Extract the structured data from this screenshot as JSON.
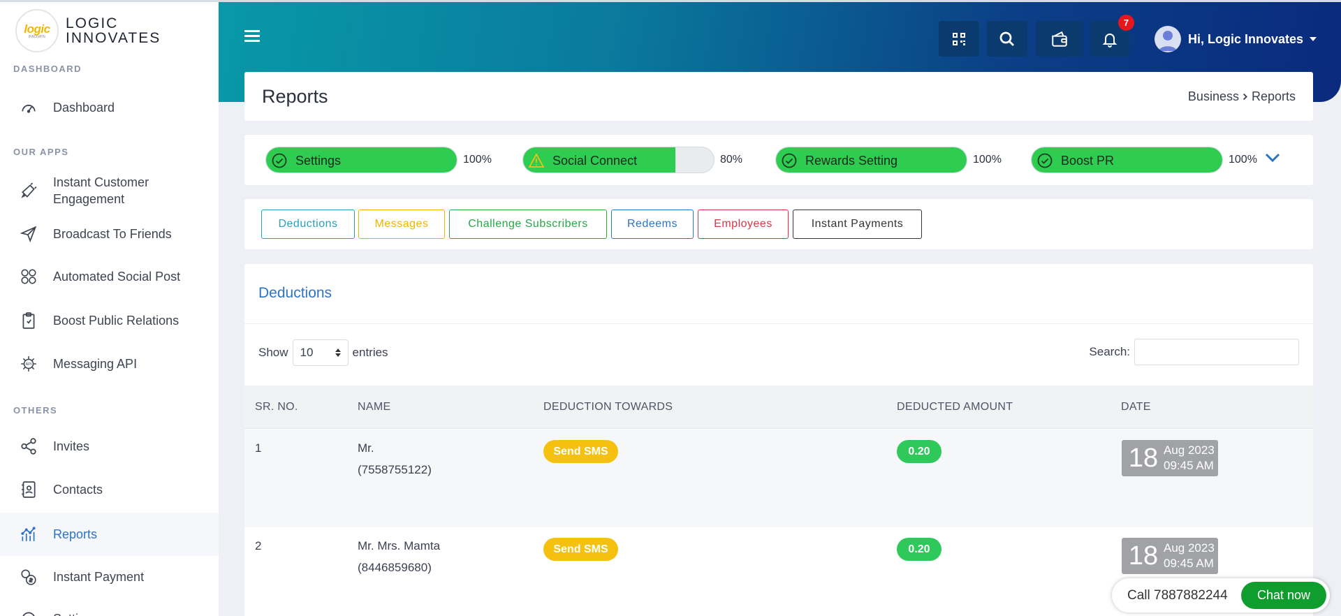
{
  "brand": {
    "logo_mark": "logic",
    "logo_sub": "INNOVATE",
    "name_line1": "LOGIC",
    "name_line2": "INNOVATES"
  },
  "sidebar": {
    "sections": [
      "DASHBOARD",
      "OUR APPS",
      "OTHERS"
    ],
    "items": [
      {
        "label": "Dashboard",
        "icon": "gauge-icon"
      },
      {
        "label": "Instant Customer Engagement",
        "icon": "megaphone-icon"
      },
      {
        "label": "Broadcast To Friends",
        "icon": "send-icon"
      },
      {
        "label": "Automated Social Post",
        "icon": "social-icon"
      },
      {
        "label": "Boost Public Relations",
        "icon": "clipboard-icon"
      },
      {
        "label": "Messaging API",
        "icon": "api-icon"
      },
      {
        "label": "Invites",
        "icon": "share-icon"
      },
      {
        "label": "Contacts",
        "icon": "contacts-icon"
      },
      {
        "label": "Reports",
        "icon": "chart-icon"
      },
      {
        "label": "Instant Payment",
        "icon": "payment-icon"
      },
      {
        "label": "Settings",
        "icon": "gear-icon"
      }
    ]
  },
  "topbar": {
    "notifications_count": "7",
    "greeting": "Hi, Logic Innovates"
  },
  "page": {
    "title": "Reports",
    "breadcrumb": [
      "Business",
      "Reports"
    ]
  },
  "progress": [
    {
      "label": "Settings",
      "percent_text": "100%",
      "value": 100,
      "status": "complete"
    },
    {
      "label": "Social Connect",
      "percent_text": "80%",
      "value": 80,
      "status": "warning"
    },
    {
      "label": "Rewards Setting",
      "percent_text": "100%",
      "value": 100,
      "status": "complete"
    },
    {
      "label": "Boost PR",
      "percent_text": "100%",
      "value": 100,
      "status": "complete"
    }
  ],
  "tabs": [
    {
      "label": "Deductions",
      "color": "#2a9fc0"
    },
    {
      "label": "Messages",
      "color": "#f0b400"
    },
    {
      "label": "Challenge Subscribers",
      "color": "#28a745"
    },
    {
      "label": "Redeems",
      "color": "#2d73c6"
    },
    {
      "label": "Employees",
      "color": "#dc3545"
    },
    {
      "label": "Instant Payments",
      "color": "#333333"
    }
  ],
  "table": {
    "section_title": "Deductions",
    "show_label": "Show",
    "entries_value": "10",
    "entries_label": "entries",
    "search_label": "Search:",
    "columns": [
      "SR. NO.",
      "NAME",
      "DEDUCTION TOWARDS",
      "DEDUCTED AMOUNT",
      "DATE"
    ],
    "rows": [
      {
        "sr": "1",
        "name": "Mr.",
        "phone": "(7558755122)",
        "towards": "Send SMS",
        "amount": "0.20",
        "day": "18",
        "month_year": "Aug 2023",
        "time": "09:45 AM"
      },
      {
        "sr": "2",
        "name": "Mr. Mrs. Mamta",
        "phone": "(8446859680)",
        "towards": "Send SMS",
        "amount": "0.20",
        "day": "18",
        "month_year": "Aug 2023",
        "time": "09:45 AM"
      }
    ]
  },
  "chat": {
    "call_text": "Call 7887882244",
    "button": "Chat now"
  },
  "colors": {
    "accent": "#2d73c6",
    "success": "#2ecc50",
    "warning": "#f5c10e"
  }
}
